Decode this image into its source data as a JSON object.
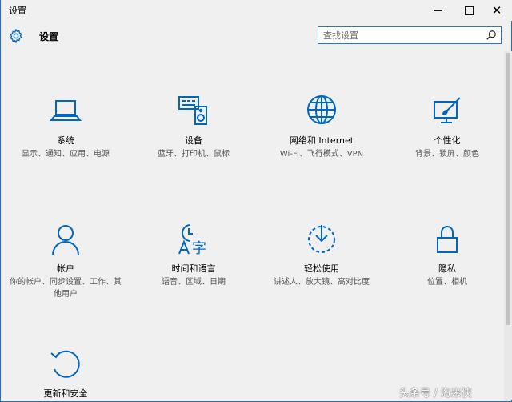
{
  "window": {
    "title": "设置"
  },
  "header": {
    "title": "设置"
  },
  "search": {
    "placeholder": "查找设置"
  },
  "tiles": [
    {
      "name": "系统",
      "desc": "显示、通知、应用、电源",
      "icon": "laptop-icon"
    },
    {
      "name": "设备",
      "desc": "蓝牙、打印机、鼠标",
      "icon": "devices-icon"
    },
    {
      "name": "网络和 Internet",
      "desc": "Wi-Fi、飞行模式、VPN",
      "icon": "globe-icon"
    },
    {
      "name": "个性化",
      "desc": "背景、锁屏、颜色",
      "icon": "paint-icon"
    },
    {
      "name": "帐户",
      "desc": "你的帐户、同步设置、工作、其他用户",
      "icon": "person-icon"
    },
    {
      "name": "时间和语言",
      "desc": "语音、区域、日期",
      "icon": "time-language-icon"
    },
    {
      "name": "轻松使用",
      "desc": "讲述人、放大镜、高对比度",
      "icon": "ease-of-access-icon"
    },
    {
      "name": "隐私",
      "desc": "位置、相机",
      "icon": "lock-icon"
    },
    {
      "name": "更新和安全",
      "desc": "",
      "icon": "update-icon"
    }
  ],
  "watermark": "头条号 / 海米侠",
  "colors": {
    "accent": "#0067c0",
    "background": "#f0f0f0",
    "border": "#1e6fcb"
  }
}
